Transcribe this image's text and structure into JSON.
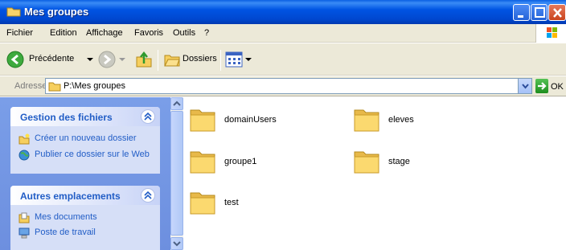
{
  "window": {
    "title": "Mes groupes"
  },
  "menu": [
    {
      "label": "Fichier"
    },
    {
      "label": "Edition"
    },
    {
      "label": "Affichage"
    },
    {
      "label": "Favoris"
    },
    {
      "label": "Outils"
    },
    {
      "label": "?"
    }
  ],
  "toolbar": {
    "back_label": "Précédente",
    "folders_label": "Dossiers"
  },
  "address": {
    "label": "Adresse",
    "value": "P:\\Mes groupes",
    "go_label": "OK"
  },
  "tasks": {
    "file_panel": {
      "title": "Gestion des fichiers",
      "items": [
        {
          "label": "Créer un nouveau dossier",
          "icon": "new-folder-icon"
        },
        {
          "label": "Publier ce dossier sur le Web",
          "icon": "publish-web-icon"
        }
      ]
    },
    "other_panel": {
      "title": "Autres emplacements",
      "items": [
        {
          "label": "Mes documents",
          "icon": "my-documents-icon"
        },
        {
          "label": "Poste de travail",
          "icon": "my-computer-icon"
        }
      ]
    }
  },
  "folders": [
    {
      "name": "domainUsers"
    },
    {
      "name": "eleves"
    },
    {
      "name": "groupe1"
    },
    {
      "name": "stage"
    },
    {
      "name": "test"
    }
  ],
  "colors": {
    "titlebar": "#0054e3",
    "taskpane": "#7a9ee8",
    "task_link": "#215dc6",
    "folder_yellow": "#f8d46a"
  }
}
